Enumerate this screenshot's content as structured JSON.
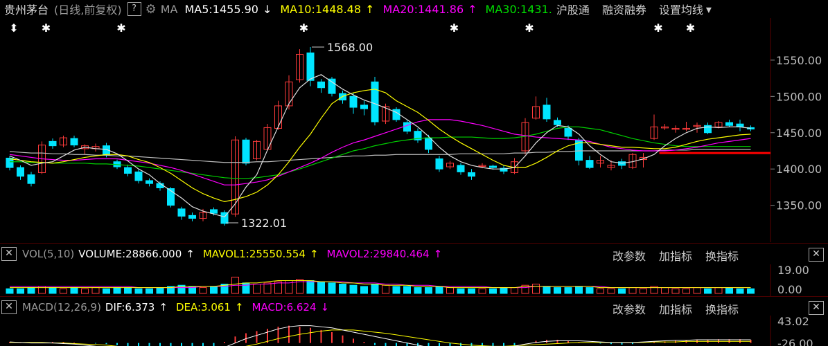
{
  "header": {
    "title": "贵州茅台",
    "period": "(日线,前复权)",
    "help": "?",
    "ma_label": "MA",
    "indicators": [
      {
        "text": "MA5:1455.90",
        "arrow": "↓",
        "color": "#ffffff"
      },
      {
        "text": "MA10:1448.48",
        "arrow": "↑",
        "color": "#ffff00"
      },
      {
        "text": "MA20:1441.86",
        "arrow": "↑",
        "color": "#ff00ff"
      },
      {
        "text": "MA30:1431.",
        "arrow": "",
        "color": "#00e000"
      }
    ],
    "links": [
      "沪股通",
      "融资融券",
      "设置均线"
    ],
    "dropdown_arrow": "▾"
  },
  "main_axis": {
    "ticks": [
      "1550.00",
      "1500.00",
      "1450.00",
      "1400.00",
      "1350.00"
    ]
  },
  "annotations": {
    "high": "1568.00",
    "low": "1322.01"
  },
  "volume_panel": {
    "close": "✕",
    "label": "VOL(5,10)",
    "volume": "VOLUME:28866.000",
    "mavol1": "MAVOL1:25550.554",
    "mavol2": "MAVOL2:29840.464",
    "arrow_up": "↑",
    "buttons": [
      "改参数",
      "加指标",
      "换指标"
    ],
    "ticks": [
      "19.00",
      "0.00"
    ]
  },
  "macd_panel": {
    "close": "✕",
    "label": "MACD(12,26,9)",
    "dif": "DIF:6.373",
    "dif_arrow": "↑",
    "dea": "DEA:3.061",
    "dea_arrow": "↑",
    "macd": "MACD:6.624",
    "macd_arrow": "↓",
    "buttons": [
      "改参数",
      "加指标",
      "换指标"
    ],
    "ticks": [
      "43.02",
      "-26.00"
    ]
  },
  "colors": {
    "up": "#ff3b3b",
    "down": "#00e5ff",
    "ma5": "#dddddd",
    "ma10": "#ffff00",
    "ma20": "#ff00ff",
    "ma30": "#00d000",
    "ma60": "#bbbbbb",
    "support": "#ff0000"
  },
  "chart_data": {
    "type": "candlestick",
    "ylim": [
      1300,
      1600
    ],
    "candles": [
      {
        "o": 1415,
        "c": 1402,
        "h": 1418,
        "l": 1398
      },
      {
        "o": 1402,
        "c": 1390,
        "h": 1405,
        "l": 1385
      },
      {
        "o": 1392,
        "c": 1380,
        "h": 1396,
        "l": 1376
      },
      {
        "o": 1395,
        "c": 1433,
        "h": 1438,
        "l": 1393
      },
      {
        "o": 1438,
        "c": 1432,
        "h": 1442,
        "l": 1428
      },
      {
        "o": 1433,
        "c": 1443,
        "h": 1446,
        "l": 1430
      },
      {
        "o": 1442,
        "c": 1433,
        "h": 1446,
        "l": 1430
      },
      {
        "o": 1428,
        "c": 1432,
        "h": 1434,
        "l": 1420
      },
      {
        "o": 1428,
        "c": 1431,
        "h": 1435,
        "l": 1424
      },
      {
        "o": 1432,
        "c": 1420,
        "h": 1436,
        "l": 1416
      },
      {
        "o": 1410,
        "c": 1403,
        "h": 1413,
        "l": 1400
      },
      {
        "o": 1402,
        "c": 1394,
        "h": 1406,
        "l": 1390
      },
      {
        "o": 1396,
        "c": 1384,
        "h": 1399,
        "l": 1380
      },
      {
        "o": 1384,
        "c": 1380,
        "h": 1387,
        "l": 1376
      },
      {
        "o": 1380,
        "c": 1374,
        "h": 1383,
        "l": 1370
      },
      {
        "o": 1373,
        "c": 1350,
        "h": 1375,
        "l": 1347
      },
      {
        "o": 1345,
        "c": 1335,
        "h": 1348,
        "l": 1330
      },
      {
        "o": 1336,
        "c": 1332,
        "h": 1340,
        "l": 1328
      },
      {
        "o": 1332,
        "c": 1340,
        "h": 1345,
        "l": 1328
      },
      {
        "o": 1344,
        "c": 1339,
        "h": 1347,
        "l": 1336
      },
      {
        "o": 1340,
        "c": 1325,
        "h": 1343,
        "l": 1322.01
      },
      {
        "o": 1338,
        "c": 1440,
        "h": 1445,
        "l": 1334
      },
      {
        "o": 1440,
        "c": 1408,
        "h": 1443,
        "l": 1405
      },
      {
        "o": 1414,
        "c": 1438,
        "h": 1440,
        "l": 1412
      },
      {
        "o": 1427,
        "c": 1457,
        "h": 1462,
        "l": 1425
      },
      {
        "o": 1456,
        "c": 1487,
        "h": 1494,
        "l": 1454
      },
      {
        "o": 1487,
        "c": 1520,
        "h": 1529,
        "l": 1482
      },
      {
        "o": 1523,
        "c": 1558,
        "h": 1565,
        "l": 1519
      },
      {
        "o": 1560,
        "c": 1522,
        "h": 1568,
        "l": 1514
      },
      {
        "o": 1520,
        "c": 1512,
        "h": 1524,
        "l": 1505
      },
      {
        "o": 1524,
        "c": 1504,
        "h": 1527,
        "l": 1500
      },
      {
        "o": 1504,
        "c": 1495,
        "h": 1508,
        "l": 1490
      },
      {
        "o": 1500,
        "c": 1485,
        "h": 1505,
        "l": 1476
      },
      {
        "o": 1488,
        "c": 1483,
        "h": 1494,
        "l": 1474
      },
      {
        "o": 1520,
        "c": 1465,
        "h": 1527,
        "l": 1460
      },
      {
        "o": 1466,
        "c": 1486,
        "h": 1490,
        "l": 1462
      },
      {
        "o": 1482,
        "c": 1468,
        "h": 1485,
        "l": 1465
      },
      {
        "o": 1464,
        "c": 1452,
        "h": 1467,
        "l": 1448
      },
      {
        "o": 1452,
        "c": 1440,
        "h": 1456,
        "l": 1436
      },
      {
        "o": 1443,
        "c": 1427,
        "h": 1447,
        "l": 1422
      },
      {
        "o": 1414,
        "c": 1400,
        "h": 1418,
        "l": 1396
      },
      {
        "o": 1403,
        "c": 1408,
        "h": 1411,
        "l": 1400
      },
      {
        "o": 1405,
        "c": 1396,
        "h": 1408,
        "l": 1392
      },
      {
        "o": 1395,
        "c": 1390,
        "h": 1400,
        "l": 1385
      },
      {
        "o": 1405,
        "c": 1405,
        "h": 1408,
        "l": 1401
      },
      {
        "o": 1404,
        "c": 1402,
        "h": 1406,
        "l": 1399
      },
      {
        "o": 1401,
        "c": 1397,
        "h": 1405,
        "l": 1393
      },
      {
        "o": 1395,
        "c": 1410,
        "h": 1415,
        "l": 1393
      },
      {
        "o": 1425,
        "c": 1464,
        "h": 1470,
        "l": 1420
      },
      {
        "o": 1470,
        "c": 1486,
        "h": 1500,
        "l": 1468
      },
      {
        "o": 1488,
        "c": 1469,
        "h": 1498,
        "l": 1465
      },
      {
        "o": 1467,
        "c": 1461,
        "h": 1471,
        "l": 1458
      },
      {
        "o": 1456,
        "c": 1445,
        "h": 1460,
        "l": 1440
      },
      {
        "o": 1440,
        "c": 1412,
        "h": 1443,
        "l": 1405
      },
      {
        "o": 1412,
        "c": 1402,
        "h": 1418,
        "l": 1400
      },
      {
        "o": 1408,
        "c": 1412,
        "h": 1418,
        "l": 1402
      },
      {
        "o": 1402,
        "c": 1405,
        "h": 1412,
        "l": 1398
      },
      {
        "o": 1410,
        "c": 1405,
        "h": 1414,
        "l": 1400
      },
      {
        "o": 1402,
        "c": 1420,
        "h": 1422,
        "l": 1400
      },
      {
        "o": 1413,
        "c": 1416,
        "h": 1422,
        "l": 1402
      },
      {
        "o": 1442,
        "c": 1458,
        "h": 1475,
        "l": 1440
      },
      {
        "o": 1458,
        "c": 1458,
        "h": 1462,
        "l": 1454
      },
      {
        "o": 1456,
        "c": 1456,
        "h": 1460,
        "l": 1450
      },
      {
        "o": 1456,
        "c": 1456,
        "h": 1465,
        "l": 1452
      },
      {
        "o": 1460,
        "c": 1460,
        "h": 1464,
        "l": 1450
      },
      {
        "o": 1460,
        "c": 1450,
        "h": 1464,
        "l": 1448
      },
      {
        "o": 1458,
        "c": 1464,
        "h": 1466,
        "l": 1456
      },
      {
        "o": 1464,
        "c": 1460,
        "h": 1468,
        "l": 1458
      },
      {
        "o": 1462,
        "c": 1458,
        "h": 1468,
        "l": 1452
      },
      {
        "o": 1457,
        "c": 1455,
        "h": 1460,
        "l": 1452
      }
    ],
    "ma5": [
      1418,
      1412,
      1405,
      1408,
      1410,
      1418,
      1426,
      1430,
      1428,
      1427,
      1421,
      1411,
      1400,
      1392,
      1380,
      1370,
      1360,
      1348,
      1342,
      1338,
      1334,
      1352,
      1375,
      1392,
      1426,
      1458,
      1490,
      1512,
      1524,
      1530,
      1520,
      1510,
      1502,
      1495,
      1490,
      1484,
      1478,
      1468,
      1458,
      1445,
      1430,
      1418,
      1410,
      1405,
      1402,
      1400,
      1400,
      1402,
      1418,
      1436,
      1450,
      1460,
      1458,
      1448,
      1432,
      1420,
      1410,
      1408,
      1410,
      1414,
      1420,
      1432,
      1442,
      1450,
      1456,
      1458,
      1457,
      1458,
      1458,
      1456
    ],
    "ma10": [
      1414,
      1412,
      1410,
      1409,
      1408,
      1410,
      1413,
      1416,
      1418,
      1420,
      1420,
      1418,
      1413,
      1409,
      1402,
      1394,
      1384,
      1374,
      1366,
      1360,
      1355,
      1358,
      1362,
      1368,
      1378,
      1392,
      1410,
      1430,
      1448,
      1470,
      1490,
      1500,
      1505,
      1508,
      1510,
      1505,
      1494,
      1486,
      1478,
      1467,
      1455,
      1445,
      1436,
      1428,
      1420,
      1412,
      1405,
      1402,
      1402,
      1408,
      1416,
      1425,
      1432,
      1436,
      1436,
      1434,
      1432,
      1430,
      1430,
      1429,
      1428,
      1428,
      1430,
      1434,
      1438,
      1441,
      1443,
      1445,
      1447,
      1448
    ],
    "ma20": [
      1420,
      1418,
      1416,
      1414,
      1413,
      1412,
      1412,
      1413,
      1414,
      1414,
      1414,
      1412,
      1410,
      1408,
      1405,
      1402,
      1398,
      1393,
      1388,
      1383,
      1378,
      1378,
      1380,
      1382,
      1385,
      1390,
      1396,
      1402,
      1408,
      1415,
      1423,
      1430,
      1436,
      1440,
      1445,
      1450,
      1455,
      1460,
      1465,
      1468,
      1468,
      1468,
      1466,
      1463,
      1460,
      1456,
      1452,
      1448,
      1446,
      1444,
      1443,
      1442,
      1441,
      1440,
      1438,
      1434,
      1430,
      1428,
      1426,
      1425,
      1425,
      1425,
      1426,
      1428,
      1430,
      1433,
      1436,
      1438,
      1440,
      1442
    ],
    "ma30": [
      1410,
      1410,
      1409,
      1409,
      1408,
      1408,
      1408,
      1408,
      1407,
      1407,
      1406,
      1405,
      1404,
      1402,
      1400,
      1398,
      1396,
      1394,
      1392,
      1390,
      1388,
      1387,
      1387,
      1388,
      1390,
      1392,
      1396,
      1400,
      1405,
      1410,
      1415,
      1420,
      1425,
      1428,
      1432,
      1435,
      1438,
      1440,
      1442,
      1443,
      1443,
      1444,
      1444,
      1444,
      1443,
      1442,
      1442,
      1443,
      1445,
      1448,
      1452,
      1456,
      1458,
      1458,
      1456,
      1454,
      1450,
      1446,
      1442,
      1439,
      1436,
      1434,
      1432,
      1431,
      1431,
      1431,
      1431,
      1431,
      1431,
      1431
    ],
    "ma60": [
      1424,
      1423,
      1422,
      1422,
      1421,
      1421,
      1420,
      1420,
      1419,
      1419,
      1418,
      1418,
      1417,
      1416,
      1415,
      1414,
      1413,
      1412,
      1411,
      1410,
      1409,
      1409,
      1409,
      1410,
      1410,
      1411,
      1412,
      1413,
      1414,
      1415,
      1416,
      1417,
      1418,
      1418,
      1419,
      1419,
      1420,
      1420,
      1420,
      1420,
      1420,
      1420,
      1421,
      1421,
      1421,
      1421,
      1421,
      1422,
      1422,
      1423,
      1423,
      1424,
      1424,
      1425,
      1425,
      1425,
      1425,
      1425,
      1425,
      1425,
      1425,
      1426,
      1426,
      1426,
      1427,
      1427,
      1427,
      1427,
      1427,
      1427
    ],
    "support_level": 1422,
    "event_markers": [
      0,
      3,
      10,
      27,
      41,
      48,
      60,
      63
    ],
    "volume": {
      "ylim": [
        0,
        19
      ],
      "values": [
        4,
        4,
        5,
        6,
        5,
        4,
        5,
        4,
        5,
        4,
        5,
        5,
        4,
        4,
        5,
        6,
        7,
        6,
        5,
        6,
        8,
        14,
        9,
        8,
        9,
        10,
        11,
        12,
        11,
        10,
        9,
        8,
        7,
        6,
        8,
        7,
        6,
        6,
        5,
        5,
        6,
        5,
        4,
        4,
        4,
        4,
        5,
        5,
        7,
        8,
        6,
        5,
        5,
        6,
        5,
        4,
        4,
        4,
        5,
        4,
        6,
        5,
        4,
        4,
        5,
        4,
        5,
        5,
        4,
        4
      ],
      "mavol1": [
        5,
        5,
        5,
        5,
        5,
        5,
        5,
        5,
        5,
        5,
        5,
        5,
        5,
        5,
        5,
        5,
        6,
        6,
        6,
        6,
        7,
        8,
        9,
        9,
        10,
        11,
        11,
        11,
        11,
        10,
        10,
        9,
        9,
        8,
        8,
        7,
        7,
        7,
        6,
        6,
        6,
        5,
        5,
        5,
        5,
        5,
        5,
        5,
        6,
        6,
        6,
        6,
        6,
        6,
        6,
        5,
        5,
        5,
        5,
        5,
        5,
        5,
        5,
        5,
        5,
        5,
        5,
        5,
        5,
        5
      ],
      "mavol2": [
        6,
        6,
        6,
        6,
        6,
        6,
        6,
        6,
        6,
        6,
        6,
        6,
        5,
        5,
        5,
        5,
        5,
        5,
        6,
        6,
        6,
        7,
        7,
        8,
        8,
        9,
        9,
        10,
        10,
        10,
        10,
        10,
        9,
        9,
        9,
        8,
        8,
        7,
        7,
        7,
        6,
        6,
        6,
        6,
        6,
        5,
        5,
        5,
        5,
        6,
        6,
        6,
        6,
        6,
        6,
        6,
        5,
        5,
        5,
        5,
        5,
        5,
        5,
        5,
        5,
        5,
        5,
        5,
        5,
        5
      ]
    },
    "macd": {
      "ylim": [
        -26,
        43.02
      ],
      "bars": [
        2,
        1,
        0,
        1,
        2,
        2,
        1,
        0,
        -1,
        -2,
        -4,
        -6,
        -8,
        -9,
        -10,
        -12,
        -13,
        -12,
        -10,
        -6,
        2,
        12,
        18,
        22,
        26,
        30,
        32,
        30,
        28,
        24,
        20,
        14,
        8,
        2,
        -4,
        -8,
        -12,
        -16,
        -20,
        -22,
        -24,
        -25,
        -24,
        -22,
        -18,
        -14,
        -10,
        -6,
        0,
        4,
        6,
        6,
        4,
        2,
        0,
        -1,
        -2,
        -3,
        -2,
        0,
        2,
        3,
        4,
        5,
        6,
        6,
        7,
        7,
        7,
        6
      ],
      "dif": [
        2,
        1,
        0,
        0,
        0,
        -1,
        -2,
        -4,
        -6,
        -8,
        -10,
        -12,
        -14,
        -16,
        -18,
        -20,
        -21,
        -20,
        -18,
        -14,
        -8,
        0,
        8,
        14,
        20,
        26,
        30,
        32,
        32,
        30,
        28,
        24,
        20,
        16,
        12,
        8,
        4,
        0,
        -4,
        -8,
        -11,
        -13,
        -14,
        -14,
        -13,
        -11,
        -9,
        -6,
        -2,
        1,
        3,
        4,
        4,
        4,
        3,
        2,
        1,
        1,
        1,
        2,
        3,
        4,
        5,
        5,
        6,
        6,
        6,
        6,
        6,
        6
      ],
      "dea": [
        1,
        1,
        1,
        1,
        0,
        0,
        -1,
        -2,
        -3,
        -4,
        -6,
        -7,
        -9,
        -10,
        -12,
        -13,
        -14,
        -15,
        -15,
        -15,
        -13,
        -10,
        -6,
        -2,
        3,
        8,
        12,
        16,
        19,
        22,
        24,
        24,
        24,
        22,
        20,
        18,
        15,
        12,
        9,
        6,
        3,
        0,
        -2,
        -4,
        -5,
        -6,
        -6,
        -5,
        -4,
        -3,
        -2,
        -1,
        0,
        1,
        1,
        1,
        1,
        1,
        1,
        1,
        2,
        2,
        2,
        3,
        3,
        3,
        3,
        3,
        3,
        3
      ]
    }
  }
}
